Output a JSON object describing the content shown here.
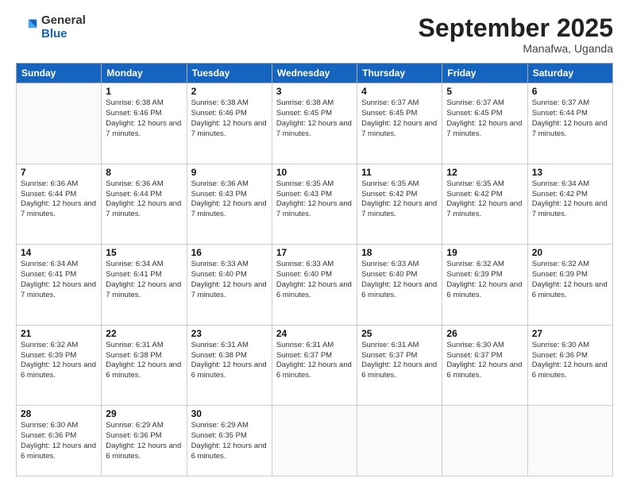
{
  "header": {
    "logo_general": "General",
    "logo_blue": "Blue",
    "month_title": "September 2025",
    "subtitle": "Manafwa, Uganda"
  },
  "weekdays": [
    "Sunday",
    "Monday",
    "Tuesday",
    "Wednesday",
    "Thursday",
    "Friday",
    "Saturday"
  ],
  "weeks": [
    [
      {
        "day": "",
        "text": ""
      },
      {
        "day": "1",
        "text": "Sunrise: 6:38 AM\nSunset: 6:46 PM\nDaylight: 12 hours\nand 7 minutes."
      },
      {
        "day": "2",
        "text": "Sunrise: 6:38 AM\nSunset: 6:46 PM\nDaylight: 12 hours\nand 7 minutes."
      },
      {
        "day": "3",
        "text": "Sunrise: 6:38 AM\nSunset: 6:45 PM\nDaylight: 12 hours\nand 7 minutes."
      },
      {
        "day": "4",
        "text": "Sunrise: 6:37 AM\nSunset: 6:45 PM\nDaylight: 12 hours\nand 7 minutes."
      },
      {
        "day": "5",
        "text": "Sunrise: 6:37 AM\nSunset: 6:45 PM\nDaylight: 12 hours\nand 7 minutes."
      },
      {
        "day": "6",
        "text": "Sunrise: 6:37 AM\nSunset: 6:44 PM\nDaylight: 12 hours\nand 7 minutes."
      }
    ],
    [
      {
        "day": "7",
        "text": "Sunrise: 6:36 AM\nSunset: 6:44 PM\nDaylight: 12 hours\nand 7 minutes."
      },
      {
        "day": "8",
        "text": "Sunrise: 6:36 AM\nSunset: 6:44 PM\nDaylight: 12 hours\nand 7 minutes."
      },
      {
        "day": "9",
        "text": "Sunrise: 6:36 AM\nSunset: 6:43 PM\nDaylight: 12 hours\nand 7 minutes."
      },
      {
        "day": "10",
        "text": "Sunrise: 6:35 AM\nSunset: 6:43 PM\nDaylight: 12 hours\nand 7 minutes."
      },
      {
        "day": "11",
        "text": "Sunrise: 6:35 AM\nSunset: 6:42 PM\nDaylight: 12 hours\nand 7 minutes."
      },
      {
        "day": "12",
        "text": "Sunrise: 6:35 AM\nSunset: 6:42 PM\nDaylight: 12 hours\nand 7 minutes."
      },
      {
        "day": "13",
        "text": "Sunrise: 6:34 AM\nSunset: 6:42 PM\nDaylight: 12 hours\nand 7 minutes."
      }
    ],
    [
      {
        "day": "14",
        "text": "Sunrise: 6:34 AM\nSunset: 6:41 PM\nDaylight: 12 hours\nand 7 minutes."
      },
      {
        "day": "15",
        "text": "Sunrise: 6:34 AM\nSunset: 6:41 PM\nDaylight: 12 hours\nand 7 minutes."
      },
      {
        "day": "16",
        "text": "Sunrise: 6:33 AM\nSunset: 6:40 PM\nDaylight: 12 hours\nand 7 minutes."
      },
      {
        "day": "17",
        "text": "Sunrise: 6:33 AM\nSunset: 6:40 PM\nDaylight: 12 hours\nand 6 minutes."
      },
      {
        "day": "18",
        "text": "Sunrise: 6:33 AM\nSunset: 6:40 PM\nDaylight: 12 hours\nand 6 minutes."
      },
      {
        "day": "19",
        "text": "Sunrise: 6:32 AM\nSunset: 6:39 PM\nDaylight: 12 hours\nand 6 minutes."
      },
      {
        "day": "20",
        "text": "Sunrise: 6:32 AM\nSunset: 6:39 PM\nDaylight: 12 hours\nand 6 minutes."
      }
    ],
    [
      {
        "day": "21",
        "text": "Sunrise: 6:32 AM\nSunset: 6:39 PM\nDaylight: 12 hours\nand 6 minutes."
      },
      {
        "day": "22",
        "text": "Sunrise: 6:31 AM\nSunset: 6:38 PM\nDaylight: 12 hours\nand 6 minutes."
      },
      {
        "day": "23",
        "text": "Sunrise: 6:31 AM\nSunset: 6:38 PM\nDaylight: 12 hours\nand 6 minutes."
      },
      {
        "day": "24",
        "text": "Sunrise: 6:31 AM\nSunset: 6:37 PM\nDaylight: 12 hours\nand 6 minutes."
      },
      {
        "day": "25",
        "text": "Sunrise: 6:31 AM\nSunset: 6:37 PM\nDaylight: 12 hours\nand 6 minutes."
      },
      {
        "day": "26",
        "text": "Sunrise: 6:30 AM\nSunset: 6:37 PM\nDaylight: 12 hours\nand 6 minutes."
      },
      {
        "day": "27",
        "text": "Sunrise: 6:30 AM\nSunset: 6:36 PM\nDaylight: 12 hours\nand 6 minutes."
      }
    ],
    [
      {
        "day": "28",
        "text": "Sunrise: 6:30 AM\nSunset: 6:36 PM\nDaylight: 12 hours\nand 6 minutes."
      },
      {
        "day": "29",
        "text": "Sunrise: 6:29 AM\nSunset: 6:36 PM\nDaylight: 12 hours\nand 6 minutes."
      },
      {
        "day": "30",
        "text": "Sunrise: 6:29 AM\nSunset: 6:35 PM\nDaylight: 12 hours\nand 6 minutes."
      },
      {
        "day": "",
        "text": ""
      },
      {
        "day": "",
        "text": ""
      },
      {
        "day": "",
        "text": ""
      },
      {
        "day": "",
        "text": ""
      }
    ]
  ]
}
